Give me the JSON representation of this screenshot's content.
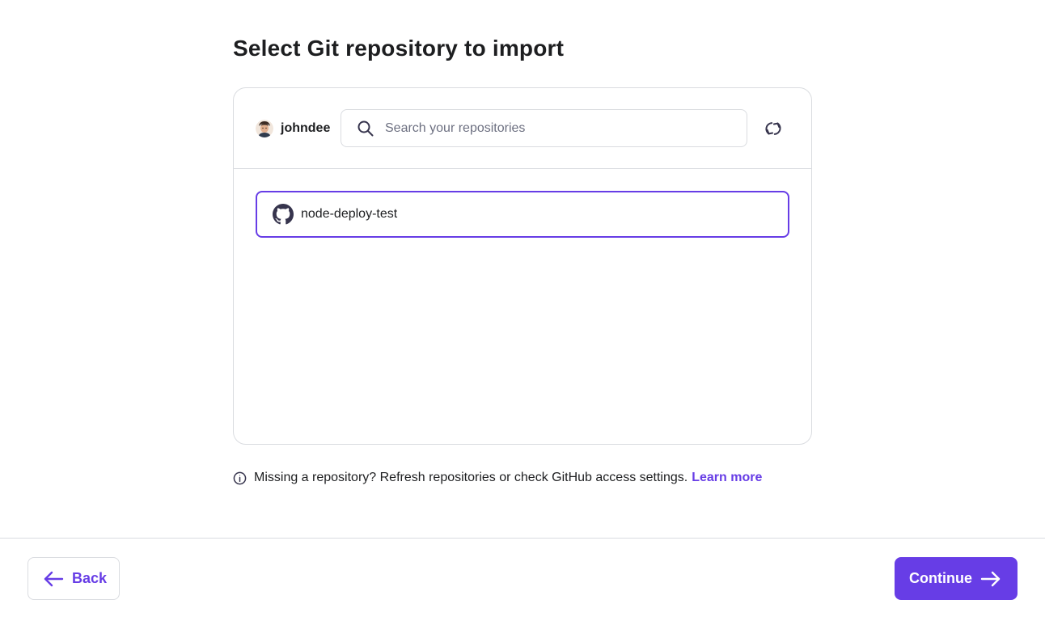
{
  "page": {
    "title": "Select Git repository to import"
  },
  "account": {
    "username": "johndee"
  },
  "search": {
    "placeholder": "Search your repositories",
    "value": ""
  },
  "repositories": [
    {
      "name": "node-deploy-test",
      "selected": true,
      "icon": "github-icon"
    }
  ],
  "hint": {
    "text": "Missing a repository? Refresh repositories or check GitHub access settings.",
    "link_label": "Learn more"
  },
  "footer": {
    "back_label": "Back",
    "continue_label": "Continue"
  },
  "colors": {
    "accent": "#673de6",
    "text": "#1d1e20",
    "border": "#dadce0",
    "muted": "#6d7081"
  },
  "icons": [
    "search-icon",
    "refresh-icon",
    "github-icon",
    "info-icon",
    "arrow-left-icon",
    "arrow-right-icon"
  ]
}
